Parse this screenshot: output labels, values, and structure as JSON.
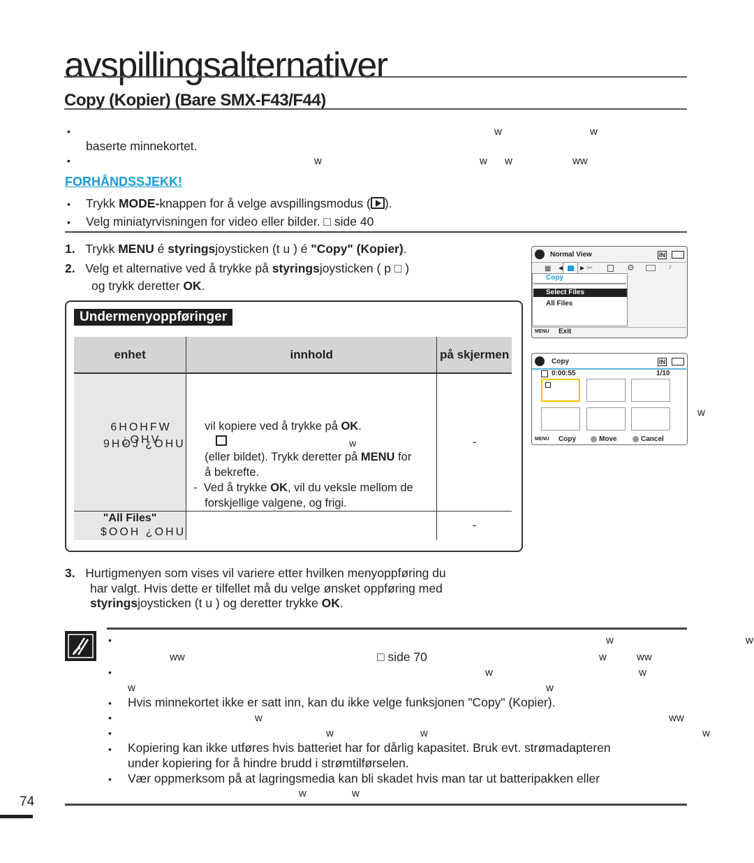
{
  "chapter_title": "avspillingsalternativer",
  "section_title": "Copy (Kopier) (Bare SMX-F43/F44)",
  "intro": {
    "bullet1_line2": "baserte minnekortet.",
    "garble_char": "w",
    "garble_pair": "ww"
  },
  "precheck": {
    "heading": "FORHÅNDSSJEKK!",
    "item1_pre": "Trykk ",
    "item1_bold": "MODE-",
    "item1_post": "knappen for å velge avspillingsmodus (",
    "item1_end": ").",
    "item2": "Velg miniatyrvisningen for video eller bilder. □ side 40"
  },
  "steps": [
    {
      "num": "1.",
      "a": "Trykk ",
      "b": "MENU",
      "c": " é  ",
      "d": "styrings",
      "e": "joysticken (t     u ) é  ",
      "f": "\"Copy\" (Kopier)",
      "g": "."
    },
    {
      "num": "2.",
      "a": "Velg et alternative ved å trykke på ",
      "b": "styrings",
      "c": "joysticken ( p     □  )",
      "line2a": "og trykk deretter ",
      "line2b": "OK",
      "line2c": "."
    },
    {
      "num": "3.",
      "line1": "Hurtigmenyen som vises vil variere etter hvilken menyoppføring du",
      "line2": "har valgt. Hvis dette er tilfellet må du velge ønsket oppføring med",
      "line3a": "styrings",
      "line3b": "joysticken (t     u ) og deretter trykke ",
      "line3c": "OK",
      "line3d": "."
    }
  ],
  "submenu": {
    "title": "Undermenyoppføringer",
    "headers": [
      "enhet",
      "innhold",
      "på skjermen"
    ],
    "row1": {
      "item_garbled1": "6HOHFW ¿OHV",
      "item_garbled2": "9HOJ ¿OHU",
      "content1a": "vil kopiere ved å trykke på ",
      "content1b": "OK",
      "content1c": ".",
      "content2": "w",
      "content3a": "(eller bildet). Trykk deretter på ",
      "content3b": "MENU",
      "content3c": " for",
      "content4": "å bekrefte.",
      "content5a": "Ved å trykke ",
      "content5b": "OK",
      "content5c": ", vil du veksle mellom de",
      "content6": "forskjellige valgene, og frigi.",
      "display": "-"
    },
    "row2": {
      "item": "\"All Files\"",
      "item_garbled": "$OOH ¿OHU",
      "display": "-"
    }
  },
  "screen1": {
    "title": "Normal View",
    "menu_header": "Copy",
    "options": [
      "Select Files",
      "All Files"
    ],
    "selected": "Select Files",
    "menu_btn": "MENU",
    "exit_label": "Exit",
    "storage": "IN"
  },
  "screen2": {
    "title": "Copy",
    "timecode": "0:00:55",
    "counter": "1/10",
    "storage": "IN",
    "footer": [
      {
        "key": "MENU",
        "label": "Copy"
      },
      {
        "key": "joystick",
        "label": "Move"
      },
      {
        "key": "ok",
        "label": "Cancel"
      }
    ],
    "side_char": "w"
  },
  "notes": {
    "side_ref": "□ side 70",
    "n3": "Hvis minnekortet ikke er satt inn, kan du ikke velge funksjonen \"Copy\" (Kopier).",
    "n6_line1": "Kopiering kan ikke utføres hvis batteriet har for dårlig kapasitet. Bruk evt. strømadapteren",
    "n6_line2": "under kopiering for å hindre brudd i strømtilførselen.",
    "n7_line1": "Vær oppmerksom på at lagringsmedia kan bli skadet hvis man tar ut batteripakken eller"
  },
  "page_number": "74",
  "colors": {
    "accent": "#1a9ad7",
    "highlight": "#f5c400"
  }
}
